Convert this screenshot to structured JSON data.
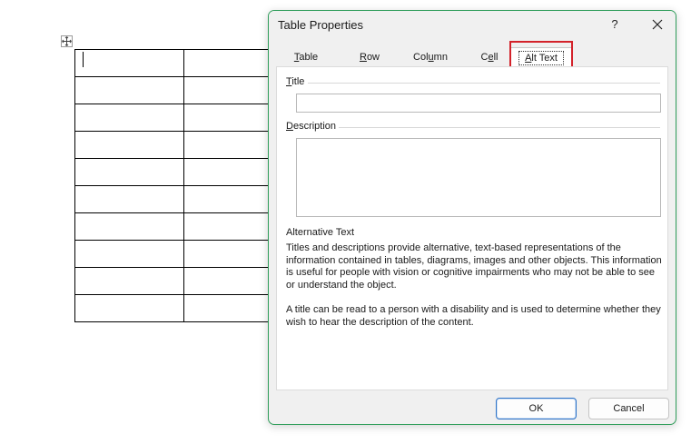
{
  "document": {
    "table_rows": 10,
    "table_cols": 2
  },
  "dialog": {
    "title": "Table Properties",
    "help_label": "?",
    "tabs": [
      {
        "pre": "",
        "u": "T",
        "post": "able"
      },
      {
        "pre": "",
        "u": "R",
        "post": "ow"
      },
      {
        "pre": "Col",
        "u": "u",
        "post": "mn"
      },
      {
        "pre": "C",
        "u": "e",
        "post": "ll"
      },
      {
        "pre": "",
        "u": "A",
        "post": "lt Text"
      }
    ],
    "active_tab": "Alt Text",
    "title_field": {
      "label_u": "T",
      "label_rest": "itle",
      "value": ""
    },
    "description_field": {
      "label_u": "D",
      "label_rest": "escription",
      "value": ""
    },
    "section_heading": "Alternative Text",
    "paragraph1": "Titles and descriptions provide alternative, text-based representations of the information contained in tables, diagrams, images and other objects. This information is useful for people with vision or cognitive impairments who may not be able to see or understand the object.",
    "paragraph2": "A title can be read to a person with a disability and is used to determine whether they wish to hear the description of the content.",
    "ok_label": "OK",
    "cancel_label": "Cancel"
  },
  "colors": {
    "dialog_border": "#2f9d5a",
    "highlight": "#d3222a",
    "ok_border": "#2f74c8"
  }
}
